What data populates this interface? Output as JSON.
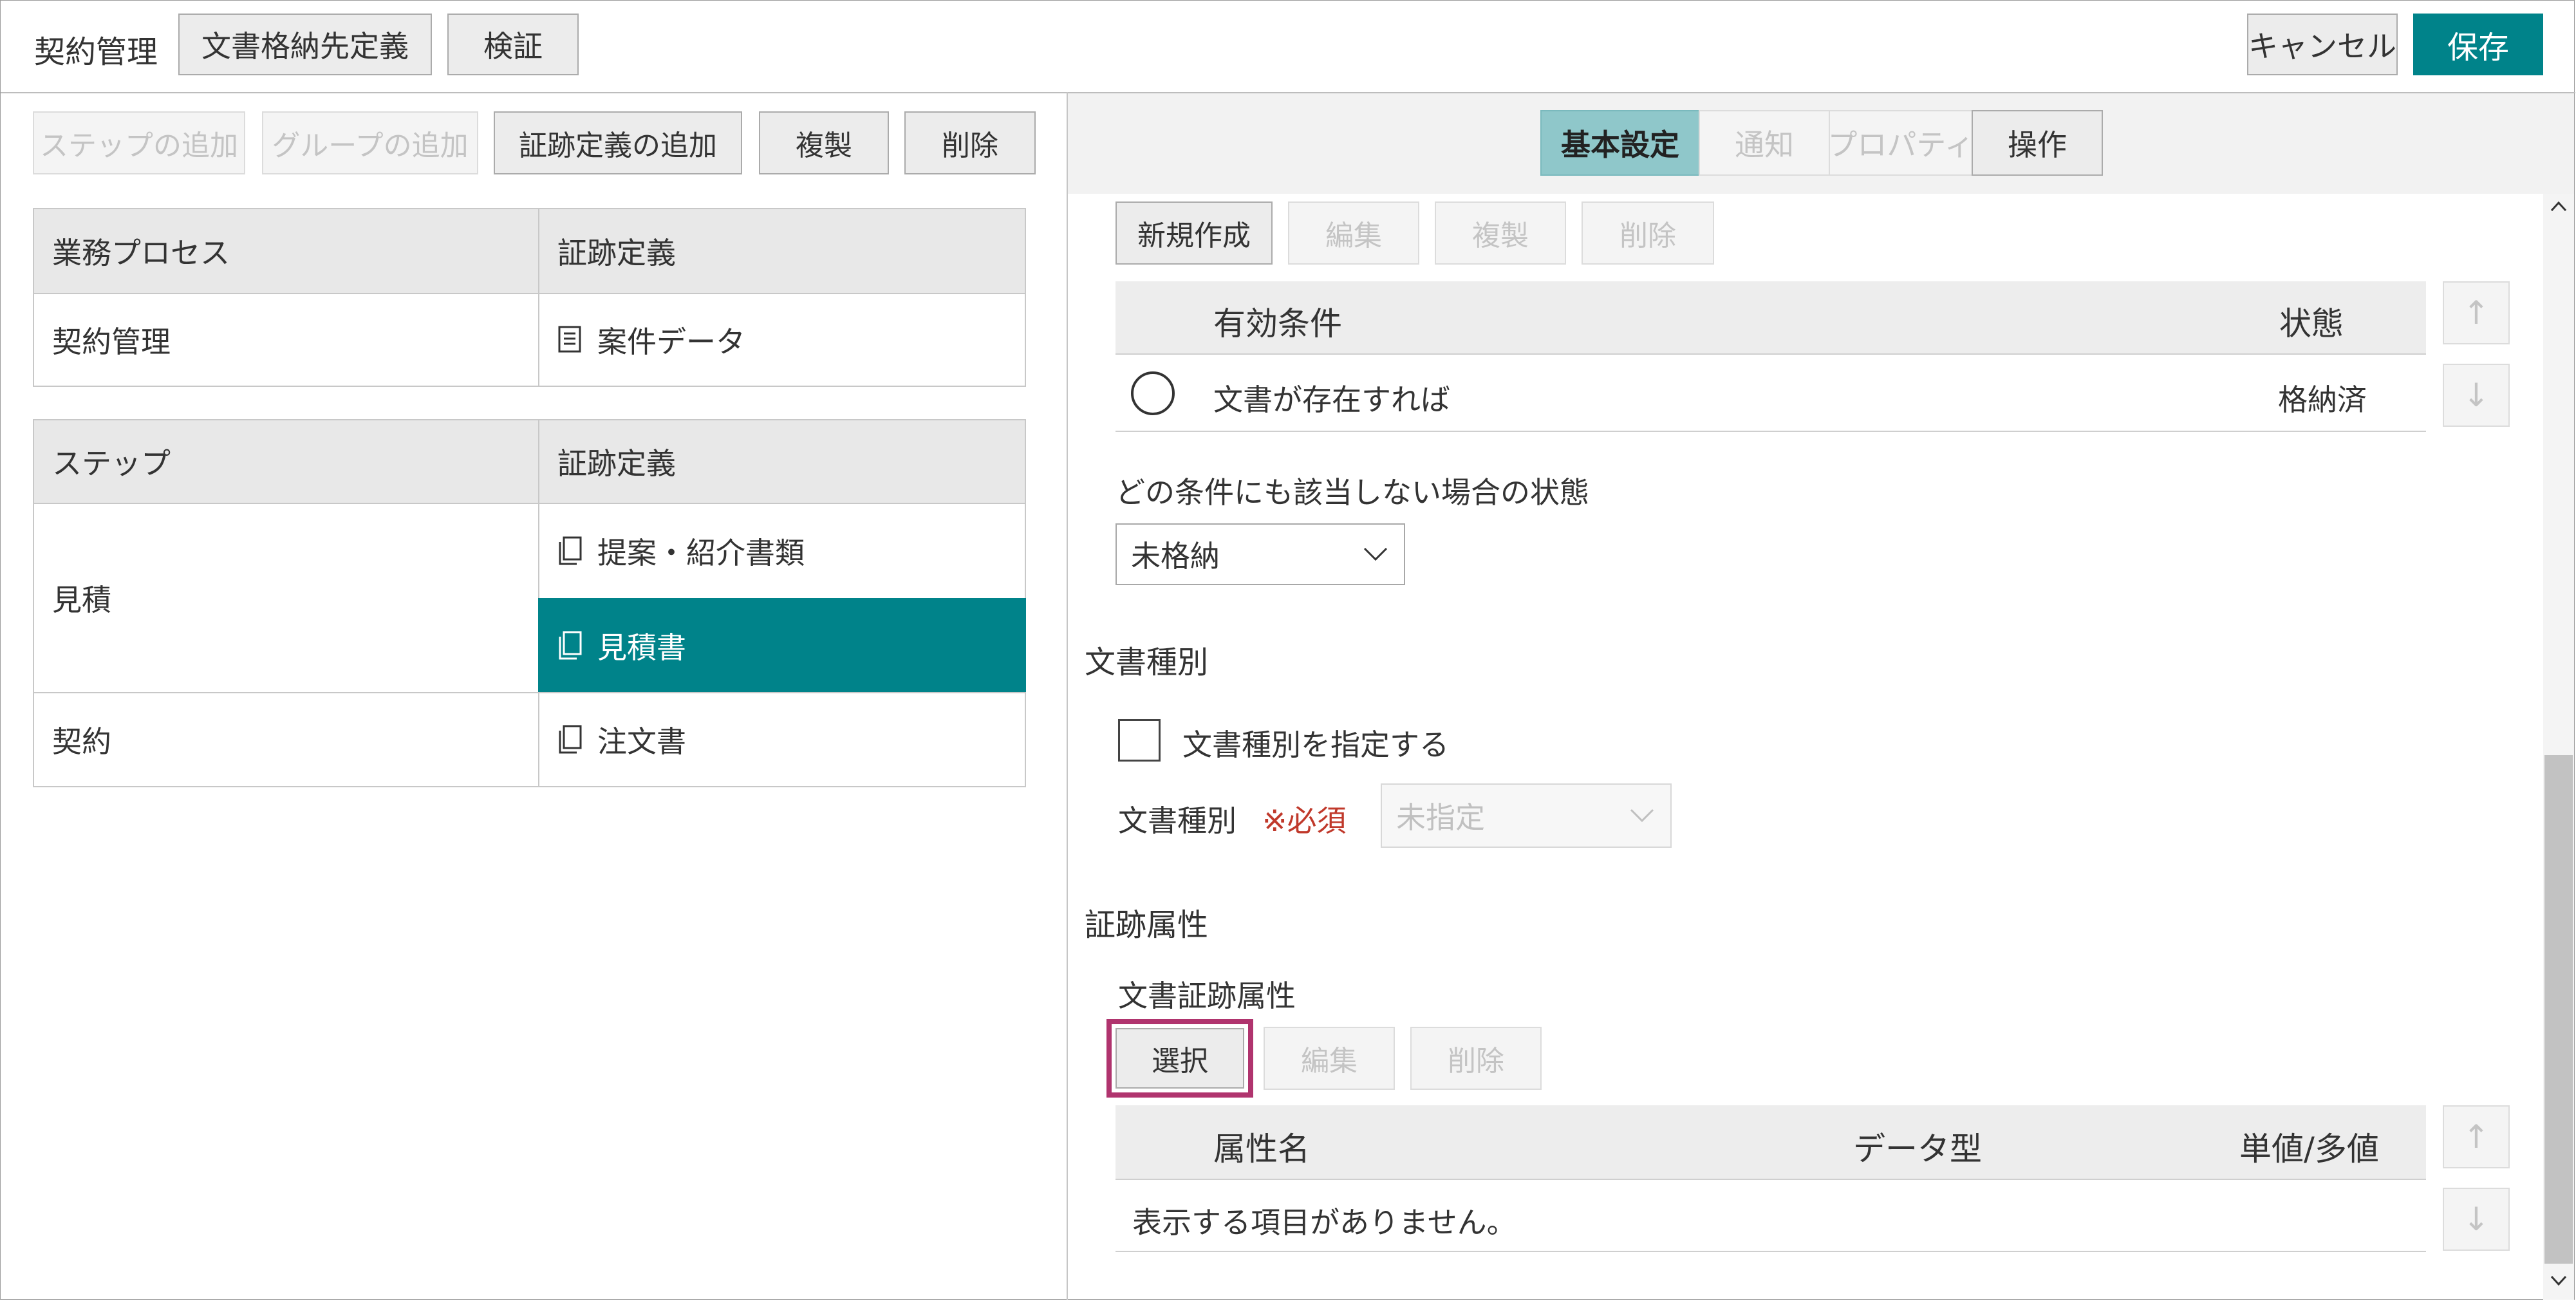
{
  "header": {
    "title": "契約管理",
    "tab_storage": "文書格納先定義",
    "verify": "検証",
    "cancel": "キャンセル",
    "save": "保存",
    "accent_color": "#00838a"
  },
  "left_toolbar": {
    "add_step": "ステップの追加",
    "add_group": "グループの追加",
    "add_evidence": "証跡定義の追加",
    "duplicate": "複製",
    "delete": "削除"
  },
  "process_table": {
    "headers": [
      "業務プロセス",
      "証跡定義"
    ],
    "row": {
      "process": "契約管理",
      "evidence": "案件データ",
      "icon": "list-document-icon"
    }
  },
  "step_table": {
    "headers": [
      "ステップ",
      "証跡定義"
    ],
    "rows": [
      {
        "step": "見積",
        "evidence": [
          "提案・紹介書類",
          "見積書"
        ],
        "selected": "見積書"
      },
      {
        "step": "契約",
        "evidence": [
          "注文書"
        ]
      }
    ],
    "icon": "copy-document-icon"
  },
  "right_tabs": {
    "basic": "基本設定",
    "notify": "通知",
    "property": "プロパティ",
    "operation": "操作"
  },
  "condition_section": {
    "toolbar": {
      "new": "新規作成",
      "edit": "編集",
      "duplicate": "複製",
      "delete": "削除"
    },
    "headers": {
      "condition": "有効条件",
      "status": "状態"
    },
    "row": {
      "condition": "文書が存在すれば",
      "status": "格納済"
    },
    "fallback_label": "どの条件にも該当しない場合の状態",
    "fallback_value": "未格納"
  },
  "doc_type_section": {
    "title": "文書種別",
    "checkbox_label": "文書種別を指定する",
    "field_label": "文書種別",
    "required": "※必須",
    "field_value": "未指定"
  },
  "evidence_attr_section": {
    "title": "証跡属性",
    "subtitle": "文書証跡属性",
    "toolbar": {
      "select": "選択",
      "edit": "編集",
      "delete": "削除"
    },
    "headers": {
      "name": "属性名",
      "type": "データ型",
      "multiplicity": "単値/多値"
    },
    "empty": "表示する項目がありません。"
  },
  "arrows": {
    "up": "↑",
    "down": "↓"
  }
}
